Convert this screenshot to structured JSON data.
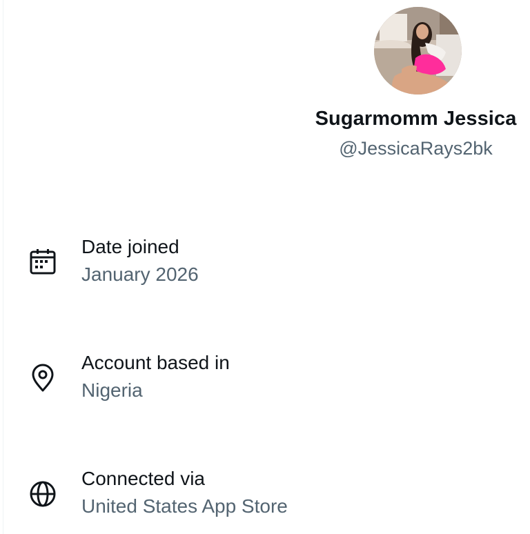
{
  "profile": {
    "display_name": "Sugarmomm Jessica",
    "handle": "@JessicaRays2bk",
    "avatar": "profile-photo"
  },
  "about": [
    {
      "icon": "calendar-icon",
      "label": "Date joined",
      "value": "January 2026"
    },
    {
      "icon": "location-pin-icon",
      "label": "Account based in",
      "value": "Nigeria"
    },
    {
      "icon": "globe-icon",
      "label": "Connected via",
      "value": "United States App Store"
    }
  ],
  "colors": {
    "primary_text": "#0f1419",
    "secondary_text": "#536471",
    "background": "#ffffff"
  }
}
